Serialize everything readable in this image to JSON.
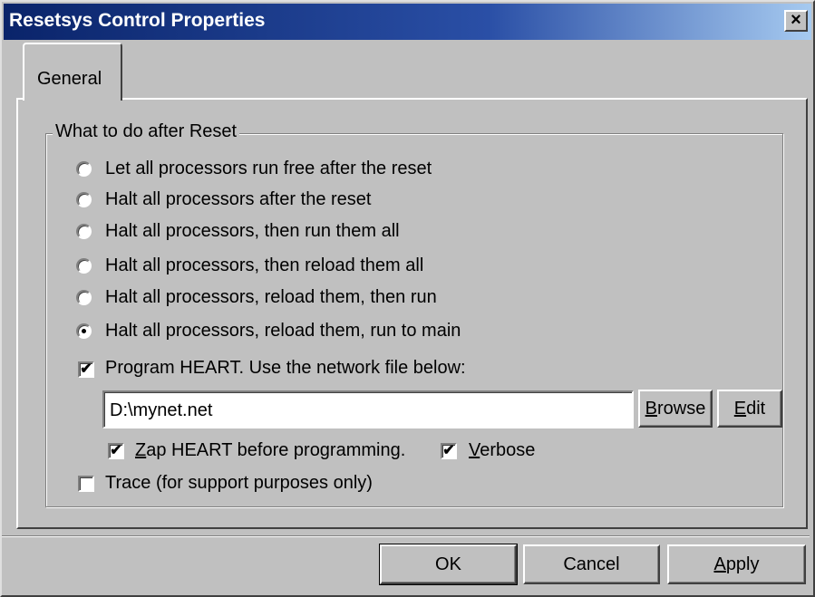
{
  "window": {
    "title": "Resetsys Control Properties",
    "close_label": "×"
  },
  "tabs": [
    {
      "label": "General"
    }
  ],
  "group": {
    "legend": "What to do after Reset",
    "radios": [
      {
        "label": "Let all processors run free after the reset",
        "checked": false
      },
      {
        "label": "Halt all processors after the reset",
        "checked": false
      },
      {
        "label": "Halt all processors, then run them all",
        "checked": false
      },
      {
        "label": "Halt all processors, then reload them all",
        "checked": false
      },
      {
        "label": "Halt all processors, reload them, then run",
        "checked": false
      },
      {
        "label": "Halt all processors, reload them, run to main",
        "checked": true
      }
    ],
    "program_heart": {
      "label": "Program HEART. Use the network file below:",
      "checked": true
    },
    "network_file": {
      "value": "D:\\mynet.net"
    },
    "browse": {
      "accel": "B",
      "rest": "rowse"
    },
    "edit": {
      "accel": "E",
      "rest": "dit"
    },
    "zap": {
      "accel": "Z",
      "rest": "ap HEART before programming.",
      "checked": true
    },
    "verbose": {
      "accel": "V",
      "rest": "erbose",
      "checked": true
    },
    "trace": {
      "label": "Trace (for support purposes only)",
      "checked": false
    }
  },
  "buttons": {
    "ok": "OK",
    "cancel": "Cancel",
    "apply": {
      "accel": "A",
      "rest": "pply"
    }
  },
  "check_glyph": "✔"
}
